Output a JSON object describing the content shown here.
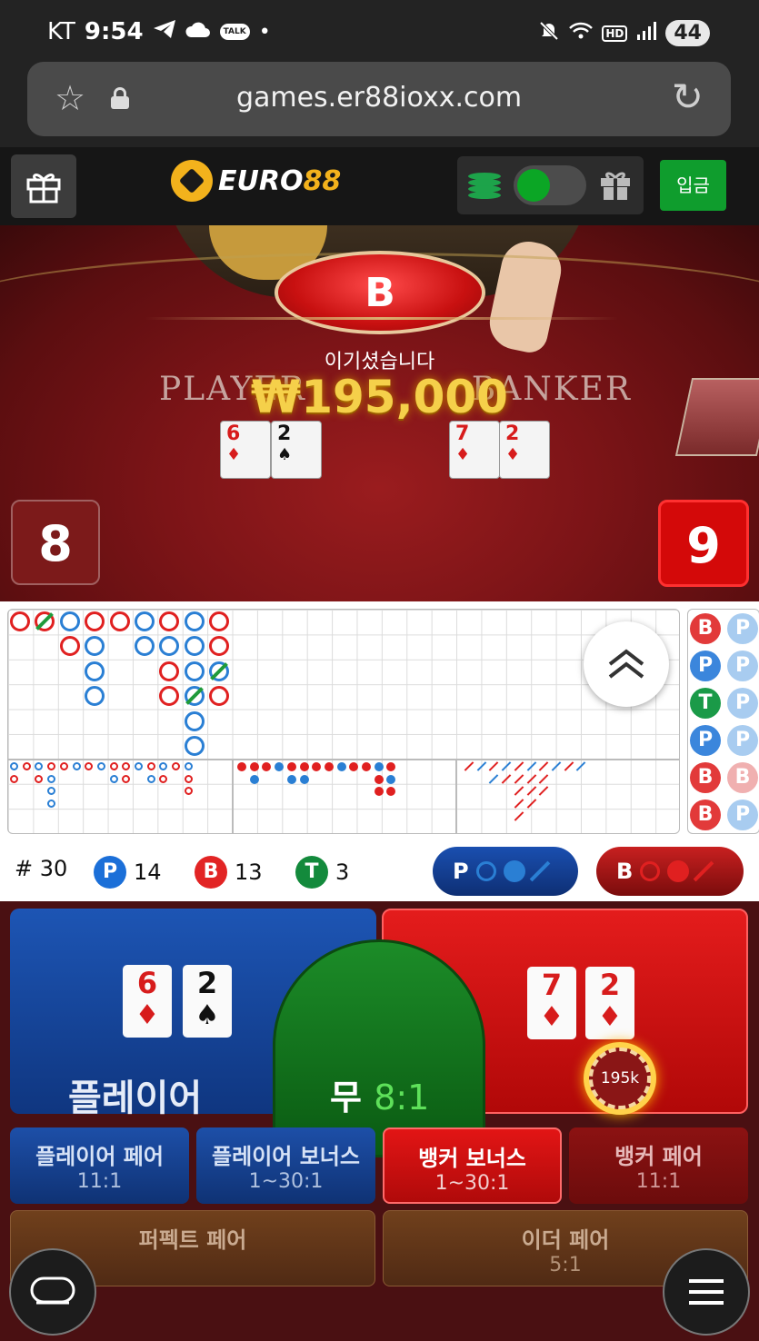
{
  "status_bar": {
    "carrier": "KT",
    "time": "9:54",
    "talk_badge": "TALK",
    "hd": "HD",
    "battery": "44"
  },
  "browser": {
    "url": "games.er88ioxx.com"
  },
  "header": {
    "logo_prefix": "EURO",
    "logo_suffix": "88",
    "deposit_label": "입금",
    "logo_color": "#f3b21c",
    "deposit_color": "#0f9d2d"
  },
  "video": {
    "result_badge": "B",
    "win_message": "이기셨습니다",
    "win_amount": "₩195,000",
    "table_left": "PLAYER",
    "table_right": "BANKER",
    "player_cards": [
      {
        "rank": "6",
        "suit": "♦"
      },
      {
        "rank": "2",
        "suit": "♠"
      }
    ],
    "banker_cards": [
      {
        "rank": "7",
        "suit": "♦"
      },
      {
        "rank": "2",
        "suit": "♦"
      }
    ],
    "player_score": "8",
    "banker_score": "9"
  },
  "stats": {
    "round_label": "# 30",
    "player_letter": "P",
    "player_count": "14",
    "banker_letter": "B",
    "banker_count": "13",
    "tie_letter": "T",
    "tie_count": "3",
    "pred_p": "P",
    "pred_b": "B"
  },
  "bead_plate": [
    [
      "B",
      "P"
    ],
    [
      "P",
      "P"
    ],
    [
      "T",
      "P"
    ],
    [
      "P",
      "P"
    ],
    [
      "B",
      "B"
    ],
    [
      "B",
      "P"
    ]
  ],
  "betting": {
    "player_label": "플레이어",
    "tie_label": "무",
    "tie_odds": "8:1",
    "chip_amount": "195k",
    "player_pair_label": "플레이어 페어",
    "player_pair_odds": "11:1",
    "player_bonus_label": "플레이어 보너스",
    "player_bonus_odds": "1~30:1",
    "banker_bonus_label": "뱅커 보너스",
    "banker_bonus_odds": "1~30:1",
    "banker_pair_label": "뱅커 페어",
    "banker_pair_odds": "11:1",
    "perfect_pair_label": "퍼펙트 페어",
    "either_pair_label": "이더 페어",
    "either_pair_odds": "5:1"
  },
  "colors": {
    "player_blue": "#1b6fd8",
    "banker_red": "#e22424",
    "tie_green": "#138a3c"
  }
}
